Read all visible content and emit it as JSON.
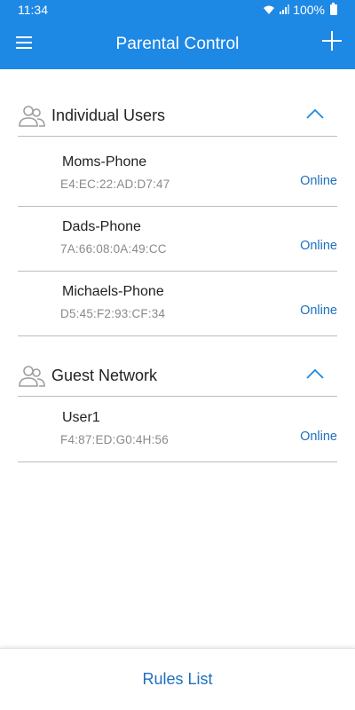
{
  "status_bar": {
    "time": "11:34",
    "battery": "100%"
  },
  "app_bar": {
    "title": "Parental Control"
  },
  "sections": [
    {
      "title": "Individual Users",
      "devices": [
        {
          "name": "Moms-Phone",
          "mac": "E4:EC:22:AD:D7:47",
          "status": "Online"
        },
        {
          "name": "Dads-Phone",
          "mac": "7A:66:08:0A:49:CC",
          "status": "Online"
        },
        {
          "name": "Michaels-Phone",
          "mac": "D5:45:F2:93:CF:34",
          "status": "Online"
        }
      ]
    },
    {
      "title": "Guest Network",
      "devices": [
        {
          "name": "User1",
          "mac": "F4:87:ED:G0:4H:56",
          "status": "Online"
        }
      ]
    }
  ],
  "bottom_bar": {
    "label": "Rules List"
  },
  "colors": {
    "header": "#1e88e5",
    "accent_text": "#1e6fbf",
    "icon_gray": "#9e9e9e",
    "chevron": "#1e88e5"
  },
  "icons": {
    "menu": "menu-icon",
    "add": "plus-icon",
    "group": "users-group-icon",
    "collapse": "chevron-up-icon"
  }
}
